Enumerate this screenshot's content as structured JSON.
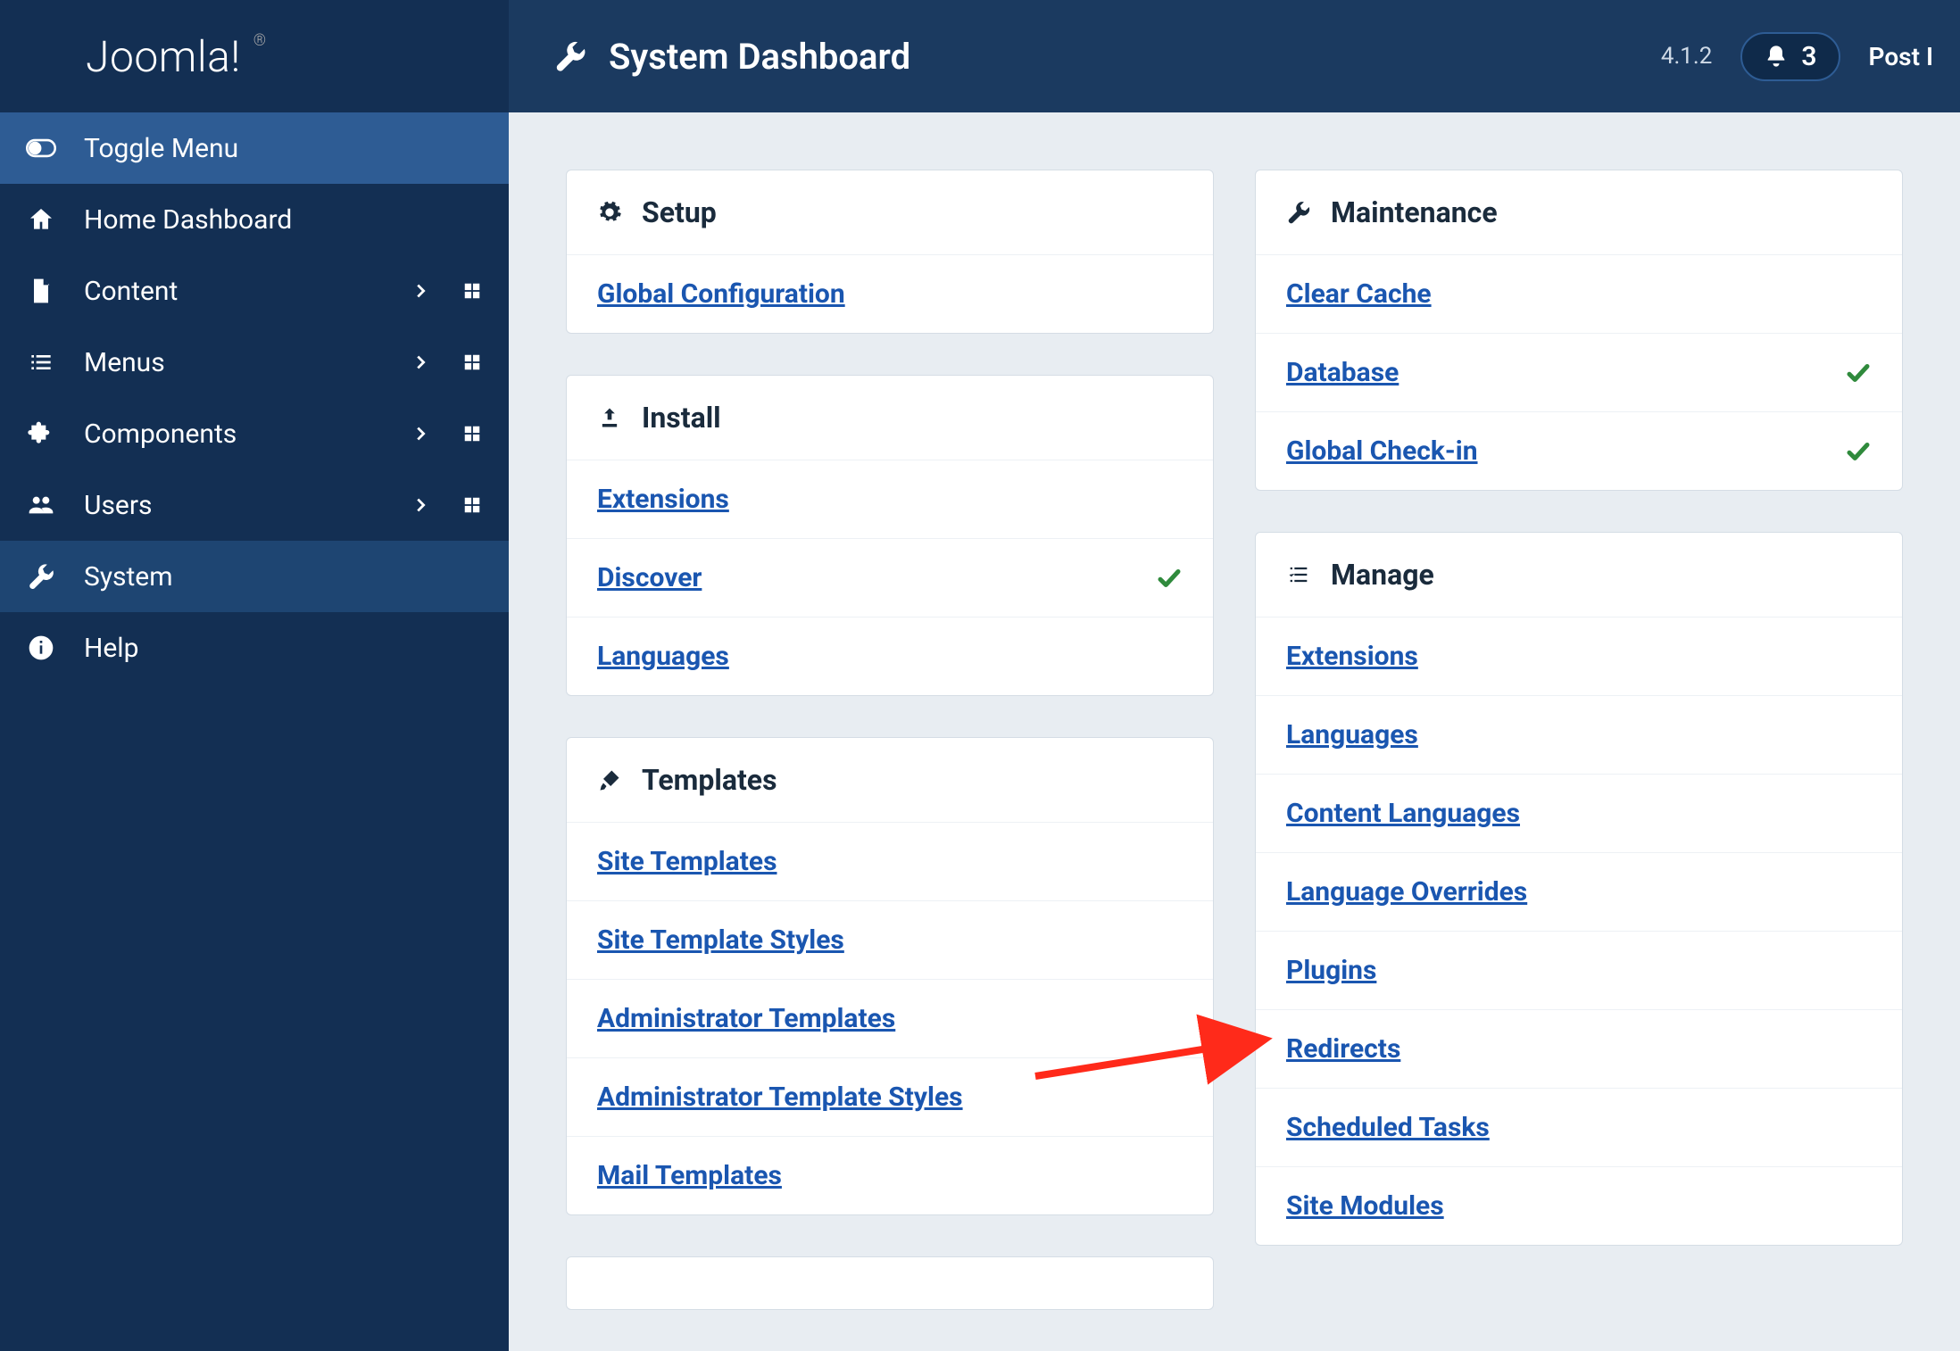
{
  "brand": {
    "name": "Joomla!",
    "tm": "®"
  },
  "header": {
    "title": "System Dashboard",
    "version_label": "4.1.2",
    "notif_count": "3",
    "post_label": "Post I"
  },
  "sidebar": {
    "toggle_label": "Toggle Menu",
    "items": [
      {
        "label": "Home Dashboard",
        "icon": "home",
        "chevron": false,
        "grid": false,
        "active": false
      },
      {
        "label": "Content",
        "icon": "file",
        "chevron": true,
        "grid": true,
        "active": false
      },
      {
        "label": "Menus",
        "icon": "list",
        "chevron": true,
        "grid": true,
        "active": false
      },
      {
        "label": "Components",
        "icon": "puzzle",
        "chevron": true,
        "grid": true,
        "active": false
      },
      {
        "label": "Users",
        "icon": "users",
        "chevron": true,
        "grid": true,
        "active": false
      },
      {
        "label": "System",
        "icon": "wrench",
        "chevron": false,
        "grid": false,
        "active": true
      },
      {
        "label": "Help",
        "icon": "info",
        "chevron": false,
        "grid": false,
        "active": false
      }
    ]
  },
  "columns": {
    "left": [
      {
        "title": "Setup",
        "icon": "cog",
        "rows": [
          {
            "label": "Global Configuration",
            "check": false
          }
        ]
      },
      {
        "title": "Install",
        "icon": "upload",
        "rows": [
          {
            "label": "Extensions",
            "check": false
          },
          {
            "label": "Discover",
            "check": true
          },
          {
            "label": "Languages",
            "check": false
          }
        ]
      },
      {
        "title": "Templates",
        "icon": "brush",
        "rows": [
          {
            "label": "Site Templates",
            "check": false
          },
          {
            "label": "Site Template Styles",
            "check": false
          },
          {
            "label": "Administrator Templates",
            "check": false
          },
          {
            "label": "Administrator Template Styles",
            "check": false
          },
          {
            "label": "Mail Templates",
            "check": false
          }
        ]
      }
    ],
    "right": [
      {
        "title": "Maintenance",
        "icon": "wrench",
        "rows": [
          {
            "label": "Clear Cache",
            "check": false
          },
          {
            "label": "Database",
            "check": true
          },
          {
            "label": "Global Check-in",
            "check": true
          }
        ]
      },
      {
        "title": "Manage",
        "icon": "list-check",
        "rows": [
          {
            "label": "Extensions",
            "check": false
          },
          {
            "label": "Languages",
            "check": false
          },
          {
            "label": "Content Languages",
            "check": false
          },
          {
            "label": "Language Overrides",
            "check": false
          },
          {
            "label": "Plugins",
            "check": false
          },
          {
            "label": "Redirects",
            "check": false
          },
          {
            "label": "Scheduled Tasks",
            "check": false
          },
          {
            "label": "Site Modules",
            "check": false
          }
        ]
      }
    ]
  }
}
